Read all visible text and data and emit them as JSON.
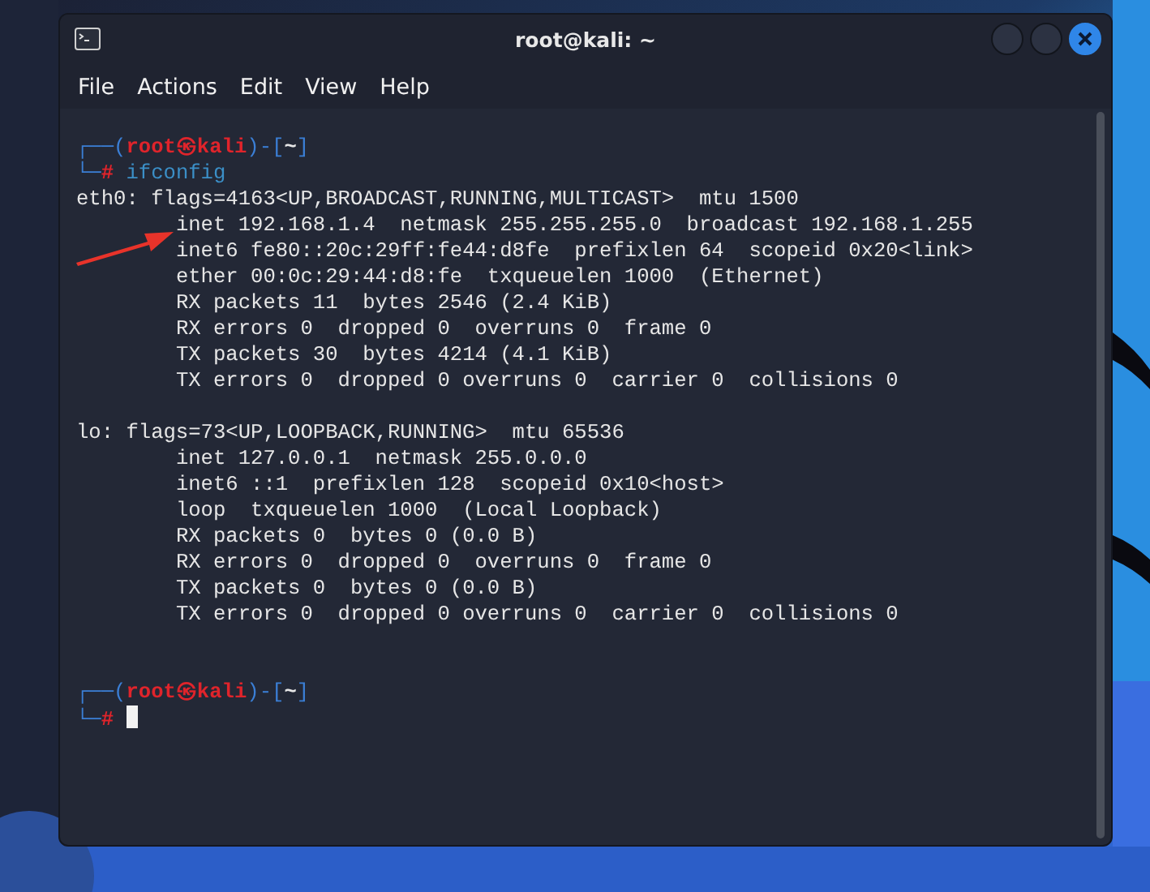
{
  "window": {
    "title": "root@kali: ~"
  },
  "menu": [
    "File",
    "Actions",
    "Edit",
    "View",
    "Help"
  ],
  "terminal": {
    "lines": [
      {
        "kind": "prompt",
        "parts": [
          {
            "text": "┌──(",
            "kind": "frame"
          },
          {
            "text": "root㉿kali",
            "kind": "user"
          },
          {
            "text": ")-[",
            "kind": "frame"
          },
          {
            "text": "~",
            "kind": "path"
          },
          {
            "text": "]",
            "kind": "frame"
          }
        ]
      },
      {
        "kind": "input",
        "cursor": false,
        "parts": [
          {
            "text": "└─",
            "kind": "frame"
          },
          {
            "text": "#",
            "kind": "sigil"
          },
          {
            "text": " ifconfig",
            "kind": "command"
          }
        ]
      },
      {
        "kind": "output",
        "text": "eth0: flags=4163<UP,BROADCAST,RUNNING,MULTICAST>  mtu 1500"
      },
      {
        "kind": "output",
        "text": "        inet 192.168.1.4  netmask 255.255.255.0  broadcast 192.168.1.255"
      },
      {
        "kind": "output",
        "text": "        inet6 fe80::20c:29ff:fe44:d8fe  prefixlen 64  scopeid 0x20<link>"
      },
      {
        "kind": "output",
        "text": "        ether 00:0c:29:44:d8:fe  txqueuelen 1000  (Ethernet)"
      },
      {
        "kind": "output",
        "text": "        RX packets 11  bytes 2546 (2.4 KiB)"
      },
      {
        "kind": "output",
        "text": "        RX errors 0  dropped 0  overruns 0  frame 0"
      },
      {
        "kind": "output",
        "text": "        TX packets 30  bytes 4214 (4.1 KiB)"
      },
      {
        "kind": "output",
        "text": "        TX errors 0  dropped 0 overruns 0  carrier 0  collisions 0"
      },
      {
        "kind": "blank"
      },
      {
        "kind": "output",
        "text": "lo: flags=73<UP,LOOPBACK,RUNNING>  mtu 65536"
      },
      {
        "kind": "output",
        "text": "        inet 127.0.0.1  netmask 255.0.0.0"
      },
      {
        "kind": "output",
        "text": "        inet6 ::1  prefixlen 128  scopeid 0x10<host>"
      },
      {
        "kind": "output",
        "text": "        loop  txqueuelen 1000  (Local Loopback)"
      },
      {
        "kind": "output",
        "text": "        RX packets 0  bytes 0 (0.0 B)"
      },
      {
        "kind": "output",
        "text": "        RX errors 0  dropped 0  overruns 0  frame 0"
      },
      {
        "kind": "output",
        "text": "        TX packets 0  bytes 0 (0.0 B)"
      },
      {
        "kind": "output",
        "text": "        TX errors 0  dropped 0 overruns 0  carrier 0  collisions 0"
      },
      {
        "kind": "blank"
      },
      {
        "kind": "blank"
      },
      {
        "kind": "prompt",
        "parts": [
          {
            "text": "┌──(",
            "kind": "frame"
          },
          {
            "text": "root㉿kali",
            "kind": "user"
          },
          {
            "text": ")-[",
            "kind": "frame"
          },
          {
            "text": "~",
            "kind": "path"
          },
          {
            "text": "]",
            "kind": "frame"
          }
        ]
      },
      {
        "kind": "input",
        "cursor": true,
        "parts": [
          {
            "text": "└─",
            "kind": "frame"
          },
          {
            "text": "#",
            "kind": "sigil"
          }
        ]
      }
    ]
  }
}
